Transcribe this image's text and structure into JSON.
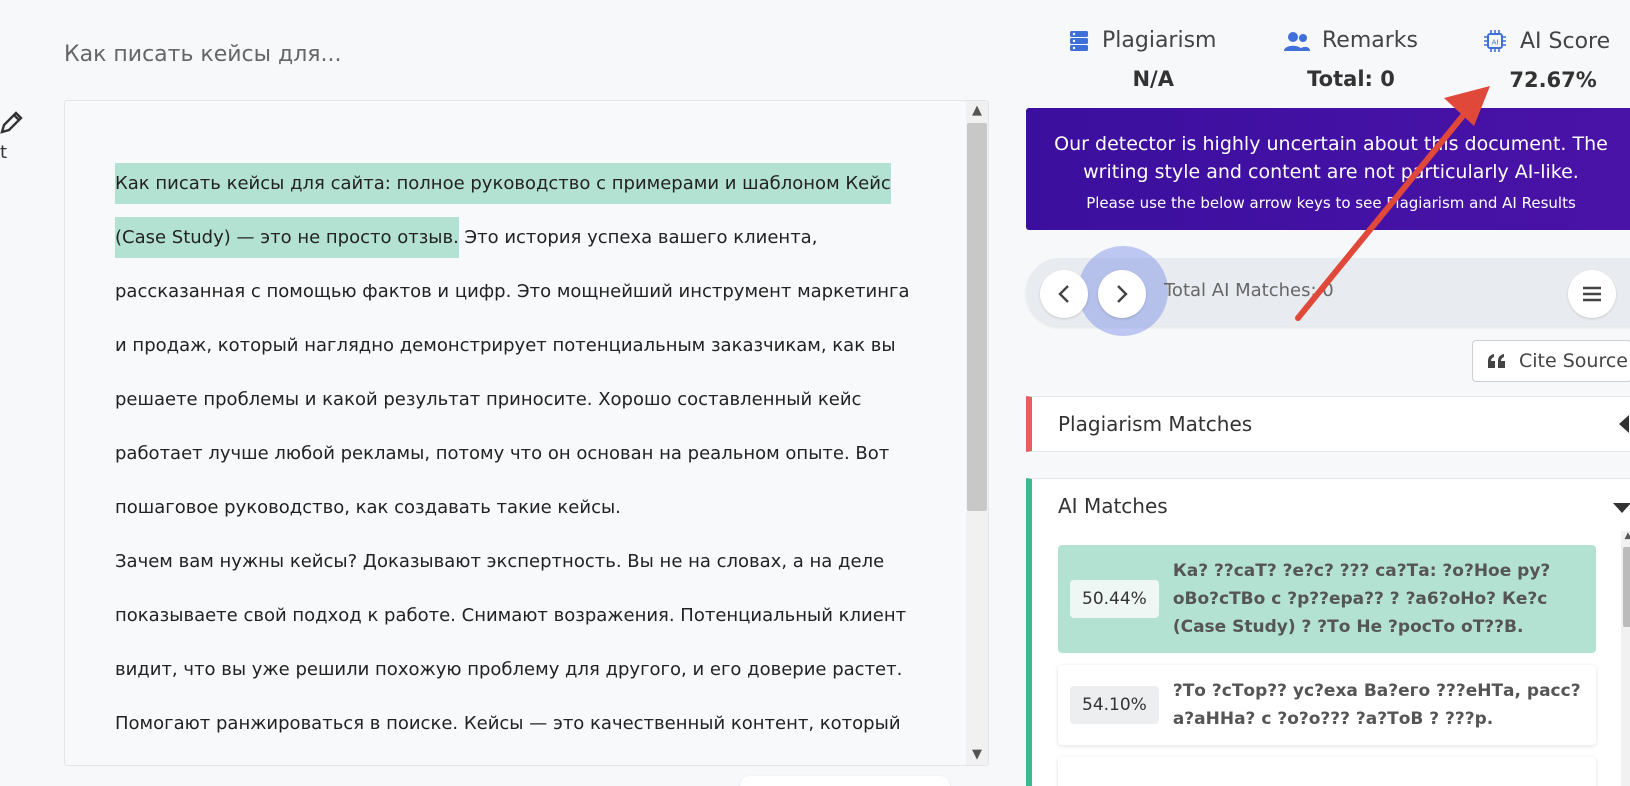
{
  "edit": {
    "label": "lit"
  },
  "document": {
    "title": "Как писать кейсы для...",
    "highlighted": "Как писать кейсы для сайта: полное руководство с примерами и шаблоном Кейс (Case Study) — это не просто отзыв.",
    "para1_rest": " Это история успеха вашего клиента, рассказанная с помощью фактов и цифр. Это мощнейший инструмент маркетинга и продаж, который наглядно демонстрирует потенциальным заказчикам, как вы решаете проблемы и какой результат приносите. Хорошо составленный кейс работает лучше любой рекламы, потому что он основан на реальном опыте. Вот пошаговое руководство, как создавать такие кейсы.",
    "para2": "Зачем вам нужны кейсы? Доказывают экспертность. Вы не на словах, а на деле показываете свой подход к работе. Снимают возражения. Потенциальный клиент видит, что вы уже решили похожую проблему для другого, и его доверие растет. Помогают ранжироваться в поиске. Кейсы — это качественный контент, который отвечает на запросы"
  },
  "stats": {
    "plagiarism": {
      "label": "Plagiarism",
      "value": "N/A"
    },
    "remarks": {
      "label": "Remarks",
      "value": "Total: 0"
    },
    "ai_score": {
      "label": "AI Score",
      "value": "72.67%"
    }
  },
  "banner": {
    "message": "Our detector is highly uncertain about this document. The writing style and content are not particularly AI-like.",
    "sub": "Please use the below arrow keys to see Plagiarism and AI Results"
  },
  "nav": {
    "count": "Total AI Matches: 0"
  },
  "cite": {
    "label": "Cite Source"
  },
  "sections": {
    "plagiarism_matches": "Plagiarism Matches",
    "ai_matches": "AI Matches"
  },
  "ai_matches": [
    {
      "pct": "50.44%",
      "text": "Ка? ??саТ? ?е?с? ??? са?Та: ?о?Ное ру?оВо?сТВо с ?р??ера?? ? ?а6?оНо? Ке?с (Case Study) ? ?То Не ?росТо оТ??В."
    },
    {
      "pct": "54.10%",
      "text": "?То ?сТор?? ус?еха Ва?его ???еНТа, расс?а?аННа? с ?о?о??? ?а?ТоВ ? ???р."
    }
  ],
  "colors": {
    "banner": "#3b0f9e",
    "plag_accent": "#e85d5d",
    "ai_accent": "#3db88f",
    "highlight": "#b4e2d2",
    "arrow": "#e0483a"
  }
}
